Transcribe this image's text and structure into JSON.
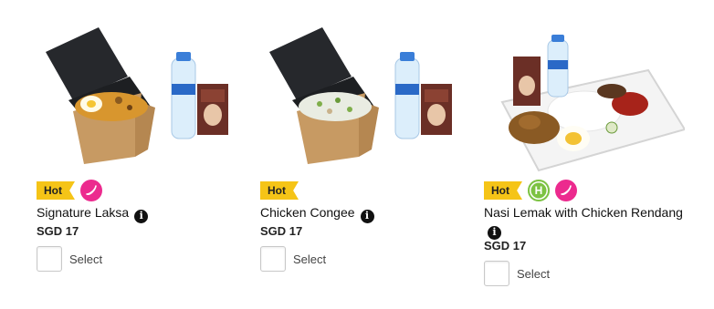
{
  "meals": [
    {
      "name": "Signature Laksa",
      "price": "SGD 17",
      "select_label": "Select",
      "badges": {
        "hot": "Hot",
        "spicy": true,
        "halal": false
      }
    },
    {
      "name": "Chicken Congee",
      "price": "SGD 17",
      "select_label": "Select",
      "badges": {
        "hot": "Hot",
        "spicy": false,
        "halal": false
      }
    },
    {
      "name": "Nasi Lemak with Chicken Rendang",
      "price": "SGD 17",
      "select_label": "Select",
      "badges": {
        "hot": "Hot",
        "spicy": true,
        "halal": true,
        "halal_letter": "H"
      }
    }
  ],
  "icons": {
    "info": "info-icon",
    "spicy": "chili-pepper-icon",
    "halal": "halal-icon"
  },
  "colors": {
    "hot_badge": "#f5c417",
    "spicy": "#ec2a8e",
    "halal": "#7cc242"
  }
}
